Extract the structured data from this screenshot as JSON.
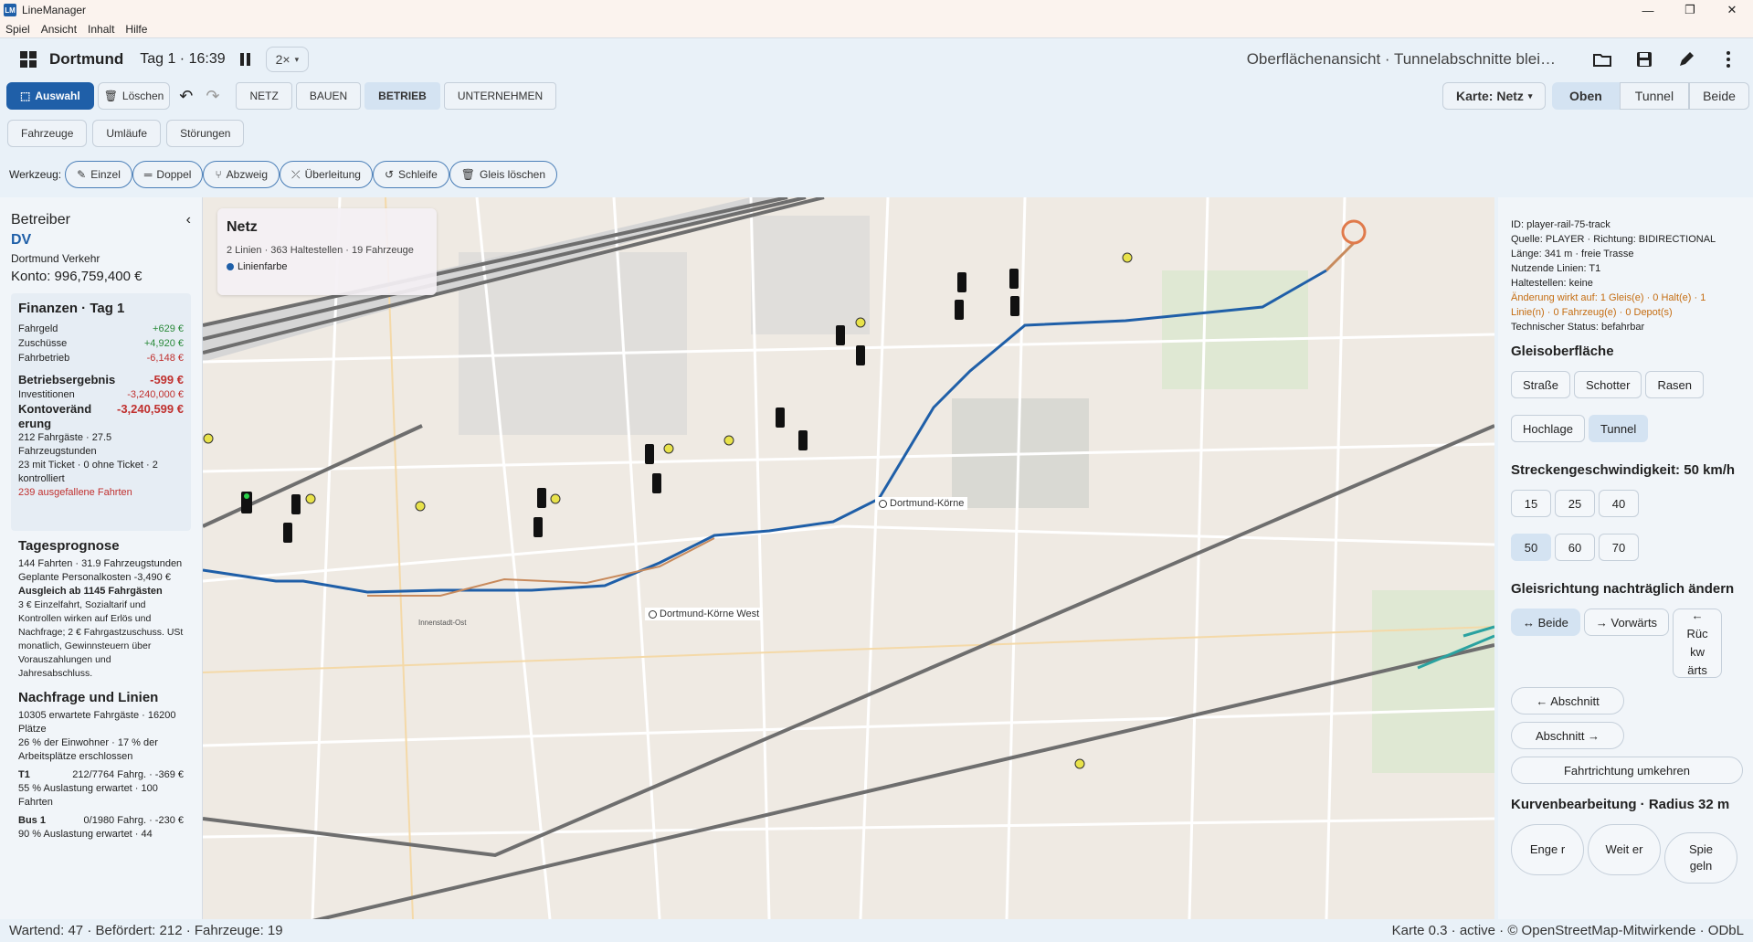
{
  "window": {
    "title": "LineManager",
    "logo": "LM"
  },
  "menu": [
    "Spiel",
    "Ansicht",
    "Inhalt",
    "Hilfe"
  ],
  "header": {
    "city": "Dortmund",
    "time": "Tag 1 · 16:39",
    "speed": "2×",
    "view_status": "Oberflächenansicht · Tunnelabschnitte blei…"
  },
  "toolbar": {
    "select": "Auswahl",
    "delete": "Löschen",
    "tabs": [
      "NETZ",
      "BAUEN",
      "BETRIEB",
      "UNTERNEHMEN"
    ],
    "map_select": "Karte: Netz",
    "view_modes": [
      "Oben",
      "Tunnel",
      "Beide"
    ]
  },
  "subtabs": [
    "Fahrzeuge",
    "Umläufe",
    "Störungen"
  ],
  "tools": {
    "label": "Werkzeug:",
    "items": [
      "Einzel",
      "Doppel",
      "Abzweig",
      "Überleitung",
      "Schleife",
      "Gleis löschen"
    ]
  },
  "left": {
    "title": "Betreiber",
    "op_short": "DV",
    "op_full": "Dortmund Verkehr",
    "balance": "Konto: 996,759,400 €",
    "finance": {
      "title": "Finanzen · Tag 1",
      "rows": [
        {
          "k": "Fahrgeld",
          "v": "+629 €"
        },
        {
          "k": "Zuschüsse",
          "v": "+4,920 €"
        },
        {
          "k": "Fahrbetrieb",
          "v": "-6,148 €"
        }
      ],
      "result_label": "Betriebsergebnis",
      "result_value": "-599 €",
      "invest_label": "Investitionen",
      "invest_value": "-3,240,000 €",
      "change_label": "Kontoveränd erung",
      "change_value": "-3,240,599 €",
      "passengers": "212 Fahrgäste · 27.5 Fahrzeugstunden",
      "tickets": "23 mit Ticket · 0 ohne Ticket · 2 kontrolliert",
      "cancelled": "239 ausgefallene Fahrten"
    },
    "forecast": {
      "title": "Tagesprognose",
      "trips": "144 Fahrten · 31.9 Fahrzeugstunden",
      "staff": "Geplante Personalkosten -3,490 €",
      "break_even": "Ausgleich ab 1145 Fahrgästen",
      "note": "3 € Einzelfahrt, Sozialtarif und Kontrollen wirken auf Erlös und Nachfrage; 2 € Fahrgastzuschuss. USt monatlich, Gewinnsteuern über Vorauszahlungen und Jahresabschluss."
    },
    "demand": {
      "title": "Nachfrage und Linien",
      "expected": "10305 erwartete Fahrgäste · 16200 Plätze",
      "coverage": "26 % der Einwohner · 17 % der Arbeitsplätze erschlossen",
      "lines": [
        {
          "name": "T1",
          "info": "212/7764 Fahrg. · -369 €",
          "load": "55 % Auslastung erwartet · 100 Fahrten"
        },
        {
          "name": "Bus 1",
          "info": "0/1980 Fahrg. · -230 €",
          "load": "90 % Auslastung erwartet · 44"
        }
      ]
    }
  },
  "map": {
    "card_title": "Netz",
    "card_summary": "2 Linien · 363 Haltestellen · 19 Fahrzeuge",
    "card_legend": "Linienfarbe",
    "stations": [
      "Dortmund-Körne",
      "Dortmund-Körne West"
    ],
    "area_label": "Innenstadt-Ost",
    "line_color": "#1f5fa8",
    "rail_color": "#6e6e6e"
  },
  "right": {
    "info": [
      "ID: player-rail-75-track",
      "Quelle: PLAYER · Richtung: BIDIRECTIONAL",
      "Länge: 341 m · freie Trasse",
      "Nutzende Linien: T1",
      "Haltestellen: keine"
    ],
    "warning": "Änderung wirkt auf: 1 Gleis(e) · 0 Halt(e) · 1 Linie(n) · 0 Fahrzeug(e) · 0 Depot(s)",
    "tech_status": "Technischer Status: befahrbar",
    "surface_title": "Gleisoberfläche",
    "surfaces": [
      "Straße",
      "Schotter",
      "Rasen"
    ],
    "levels": [
      "Hochlage",
      "Tunnel"
    ],
    "speed_title": "Streckengeschwindigkeit: 50 km/h",
    "speeds": [
      "15",
      "25",
      "40",
      "50",
      "60",
      "70"
    ],
    "dir_title": "Gleisrichtung nachträglich ändern",
    "dir_both": "↔ Beide",
    "dir_fwd": "→ Vorwärts",
    "dir_back": "← Rüc kw ärts",
    "sect_prev": "← Abschnitt",
    "sect_next": "Abschnitt →",
    "reverse": "Fahrtrichtung umkehren",
    "curve_title": "Kurvenbearbeitung · Radius 32 m",
    "curve_btns": [
      "Enge r",
      "Weit er",
      "Spie geln"
    ]
  },
  "status": {
    "left": "Wartend: 47 · Befördert: 212 · Fahrzeuge: 19",
    "right": "Karte 0.3 · active · © OpenStreetMap-Mitwirkende · ODbL"
  }
}
